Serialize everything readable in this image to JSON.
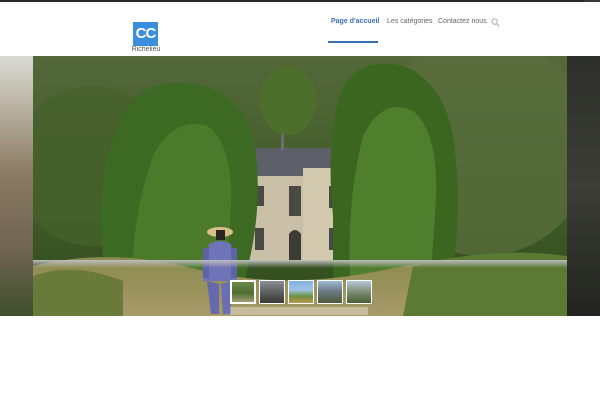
{
  "logo": {
    "mark": "CC",
    "subtitle": "Richelieu"
  },
  "nav": {
    "items": [
      {
        "label": "Page d'accueil",
        "active": true
      },
      {
        "label": "Les catégories",
        "active": false
      },
      {
        "label": "Contactez nous",
        "active": false
      }
    ],
    "search_icon": "search-icon",
    "accent_color": "#3b6fb6"
  },
  "corner": {
    "icon": "plus-icon",
    "glyph": "+"
  },
  "slider": {
    "slide_count": 5,
    "active_index": 0
  }
}
